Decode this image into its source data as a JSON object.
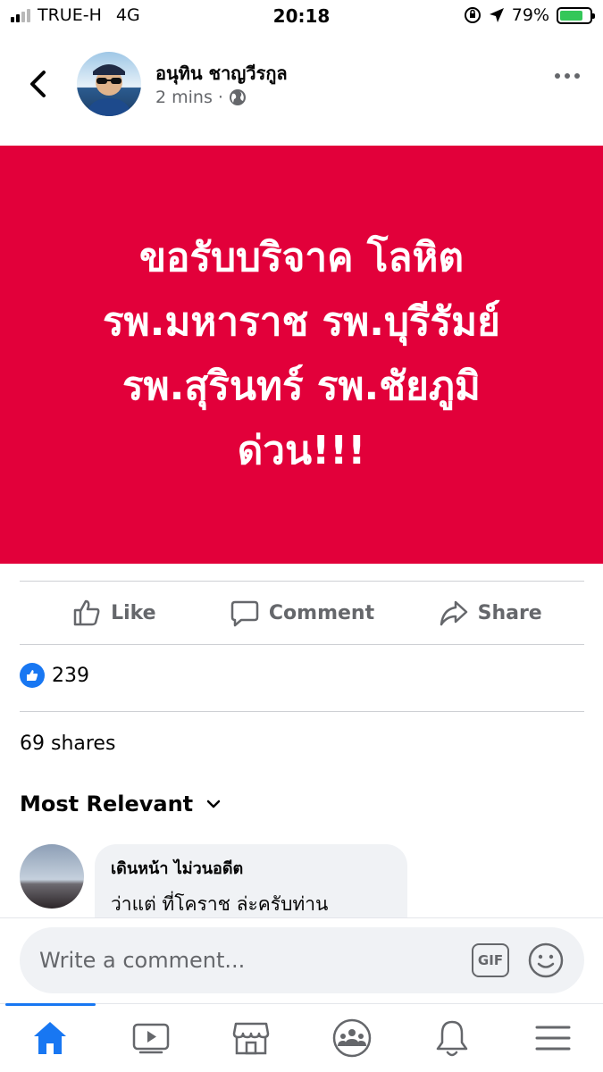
{
  "status_bar": {
    "carrier": "TRUE-H",
    "network": "4G",
    "time": "20:18",
    "battery": "79%",
    "battery_level": 0.79
  },
  "post": {
    "author": "อนุทิน ชาญวีรกูล",
    "time": "2 mins",
    "separator": "·",
    "audience_icon": "globe-icon",
    "image_text_lines": [
      "ขอรับบริจาค โลหิต",
      "รพ.มหาราช รพ.บุรีรัมย์",
      "รพ.สุรินทร์ รพ.ชัยภูมิ",
      "ด่วน!!!"
    ],
    "image_bg": "#e2003a"
  },
  "actions": {
    "like": "Like",
    "comment": "Comment",
    "share": "Share"
  },
  "stats": {
    "likes": "239",
    "shares": "69 shares"
  },
  "comments_sort": "Most Relevant",
  "comment": {
    "author": "เดินหน้า ไม่วนอดีต",
    "text": "ว่าแต่ ที่โคราช ล่ะครับท่าน"
  },
  "composer": {
    "placeholder": "Write a comment...",
    "gif_label": "GIF"
  },
  "tabs": [
    "home-icon",
    "video-icon",
    "marketplace-icon",
    "groups-icon",
    "notifications-icon",
    "menu-icon"
  ],
  "colors": {
    "accent": "#1877f2",
    "secondary_text": "#65676b"
  }
}
